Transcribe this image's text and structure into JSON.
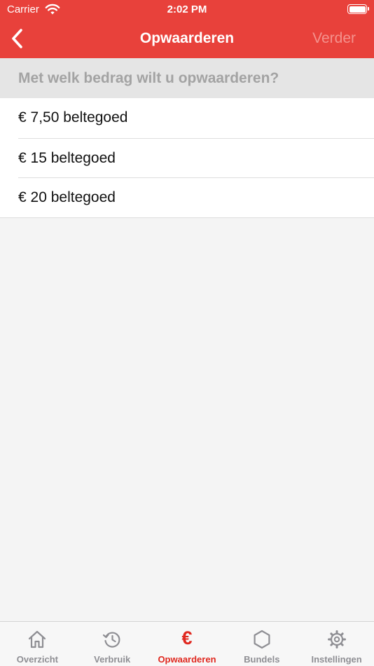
{
  "status_bar": {
    "carrier": "Carrier",
    "time": "2:02 PM"
  },
  "nav": {
    "title": "Opwaarderen",
    "next_label": "Verder",
    "back_icon": "chevron-left-icon"
  },
  "section": {
    "header": "Met welk bedrag wilt u opwaarderen?"
  },
  "amounts": [
    {
      "label": "€ 7,50 beltegoed"
    },
    {
      "label": "€ 15 beltegoed"
    },
    {
      "label": "€ 20 beltegoed"
    }
  ],
  "tabs": [
    {
      "label": "Overzicht",
      "icon": "home-icon"
    },
    {
      "label": "Verbruik",
      "icon": "history-icon"
    },
    {
      "label": "Opwaarderen",
      "icon": "euro-icon",
      "glyph": "€",
      "active": true
    },
    {
      "label": "Bundels",
      "icon": "hexagon-icon"
    },
    {
      "label": "Instellingen",
      "icon": "gear-icon"
    }
  ],
  "colors": {
    "brand": "#e8413b",
    "active_tab": "#e0281f",
    "inactive_tab": "#8e8e93",
    "disabled_action": "#f4928d"
  }
}
